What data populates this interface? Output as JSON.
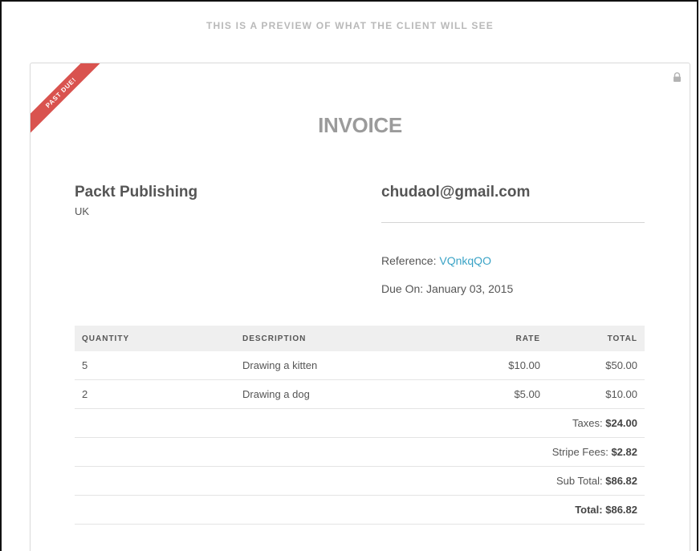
{
  "preview_banner": "THIS IS A PREVIEW OF WHAT THE CLIENT WILL SEE",
  "ribbon": {
    "label": "PAST DUE!",
    "color": "#d9534f"
  },
  "lock_icon": "lock-icon",
  "invoice": {
    "title": "INVOICE",
    "from": {
      "name": "Packt Publishing",
      "country": "UK"
    },
    "to": {
      "email": "chudaol@gmail.com"
    },
    "reference_label": "Reference:",
    "reference_value": "VQnkqQO",
    "reference_color": "#3aa3c6",
    "due_label": "Due On:",
    "due_value": "January 03, 2015",
    "columns": {
      "quantity": "QUANTITY",
      "description": "DESCRIPTION",
      "rate": "RATE",
      "total": "TOTAL"
    },
    "items": [
      {
        "quantity": "5",
        "description": "Drawing a kitten",
        "rate": "$10.00",
        "total": "$50.00"
      },
      {
        "quantity": "2",
        "description": "Drawing a dog",
        "rate": "$5.00",
        "total": "$10.00"
      }
    ],
    "taxes": {
      "label": "Taxes:",
      "value": "$24.00"
    },
    "stripe_fees": {
      "label": "Stripe Fees:",
      "value": "$2.82"
    },
    "sub_total": {
      "label": "Sub Total:",
      "value": "$86.82"
    },
    "total": {
      "label": "Total:",
      "value": "$86.82"
    }
  }
}
